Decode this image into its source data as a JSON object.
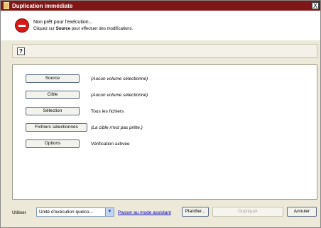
{
  "window": {
    "title": "Duplication immédiate",
    "close_glyph": "X"
  },
  "status": {
    "title": "Non prêt pour l'exécution...",
    "sub_prefix": "Cliquez sur ",
    "sub_bold": "Source",
    "sub_suffix": " pour effectuer des modifications."
  },
  "toolbar": {
    "help_glyph": "?"
  },
  "rows": [
    {
      "button": "Source",
      "value": "(Aucun volume sélectionné)",
      "italic": true
    },
    {
      "button": "Cible",
      "value": "(Aucun volume sélectionné)",
      "italic": true
    },
    {
      "button": "Sélection",
      "value": "Tous les fichiers",
      "italic": false
    },
    {
      "button": "Fichiers sélectionnés",
      "value": "(La cible n'est pas prête.)",
      "italic": true
    },
    {
      "button": "Options",
      "value": "Vérification activée",
      "italic": false
    }
  ],
  "footer": {
    "use_label": "Utiliser",
    "combo_value": "Unité d'exécution quelco...",
    "assistant_link": "Passer au mode assistant",
    "plan_button": "Planifier...",
    "duplicate_button": "Dupliquer",
    "cancel_button": "Annuler"
  },
  "colors": {
    "titlebar": "#7f1717",
    "stop": "#d61a1a",
    "link": "#0000cc"
  }
}
